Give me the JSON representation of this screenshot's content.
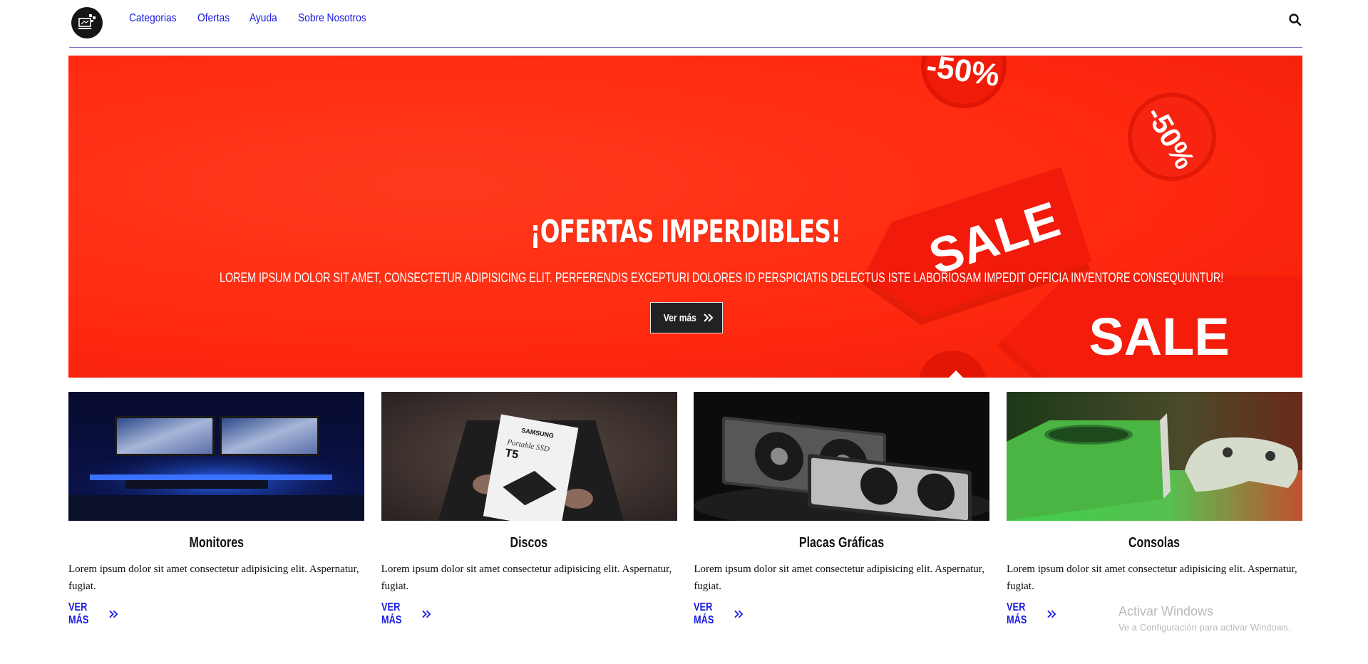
{
  "nav": {
    "items": [
      {
        "label": "Categorias"
      },
      {
        "label": "Ofertas"
      },
      {
        "label": "Ayuda"
      },
      {
        "label": "Sobre Nosotros"
      }
    ]
  },
  "hero": {
    "title": "¡OFERTAS IMPERDIBLES!",
    "subtitle": "Lorem ipsum dolor sit amet, consectetur adipisicing elit. Perferendis excepturi dolores id perspiciatis delectus iste laboriosam impedit officia inventore consequuntur!",
    "button_label": "Ver más",
    "decor_texts": {
      "badge": "-50%",
      "tag": "SALE"
    }
  },
  "cards": [
    {
      "title": "Monitores",
      "description": "Lorem ipsum dolor sit amet consectetur adipisicing elit. Aspernatur, fugiat.",
      "link": "VER MÁS"
    },
    {
      "title": "Discos",
      "description": "Lorem ipsum dolor sit amet consectetur adipisicing elit. Aspernatur, fugiat.",
      "link": "VER MÁS"
    },
    {
      "title": "Placas Gráficas",
      "description": "Lorem ipsum dolor sit amet consectetur adipisicing elit. Aspernatur, fugiat.",
      "link": "VER MÁS"
    },
    {
      "title": "Consolas",
      "description": "Lorem ipsum dolor sit amet consectetur adipisicing elit. Aspernatur, fugiat.",
      "link": "VER MÁS"
    }
  ],
  "card_images": {
    "disk_brand": "SAMSUNG",
    "disk_line": "Portable SSD",
    "disk_model": "T5"
  },
  "watermark": {
    "line1": "Activar Windows",
    "line2": "Ve a Configuración para activar Windows."
  },
  "colors": {
    "link": "#1a1ae0",
    "hero_red": "#ff2a10",
    "header_rule": "#7b68c9",
    "button_bg": "#222222"
  },
  "icons": {
    "logo": "laptop-logo-icon",
    "search": "search-icon",
    "chevrons": "double-chevron-right-icon"
  }
}
